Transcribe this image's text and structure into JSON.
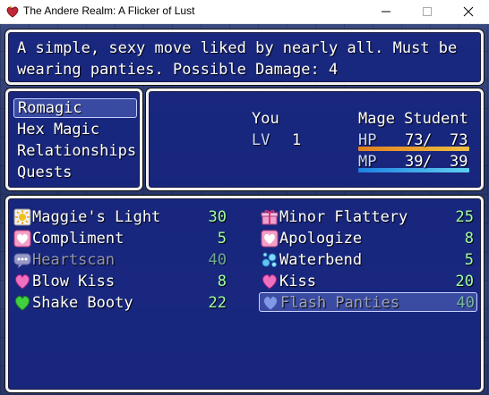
{
  "window": {
    "title": "The Andere Realm: A Flicker of Lust"
  },
  "help": {
    "line1": "A simple, sexy move liked by nearly all. Must be",
    "line2": "wearing panties. Possible Damage: 4"
  },
  "menu": {
    "items": [
      "Romagic",
      "Hex Magic",
      "Relationships",
      "Quests"
    ],
    "selected": "Romagic"
  },
  "status": {
    "name": "You",
    "level_label": "LV",
    "level": "1",
    "class": "Mage Student",
    "hp_label": "HP",
    "hp_current": "73",
    "hp_max": "73",
    "mp_label": "MP",
    "mp_current": "39",
    "mp_max": "39",
    "hp_fill": 1.0,
    "mp_fill": 1.0,
    "hp_color": "#e0a030",
    "mp_color": "#40a0e0"
  },
  "skills": {
    "left": [
      {
        "icon": "sun-icon",
        "name": "Maggie's Light",
        "cost": "30",
        "enabled": true
      },
      {
        "icon": "heart-face-icon",
        "name": "Compliment",
        "cost": "5",
        "enabled": true
      },
      {
        "icon": "speech-bubble-icon",
        "name": "Heartscan",
        "cost": "40",
        "enabled": false
      },
      {
        "icon": "pink-heart-icon",
        "name": "Blow Kiss",
        "cost": "8",
        "enabled": true
      },
      {
        "icon": "green-heart-icon",
        "name": "Shake Booty",
        "cost": "22",
        "enabled": true
      }
    ],
    "right": [
      {
        "icon": "gift-icon",
        "name": "Minor Flattery",
        "cost": "25",
        "enabled": true
      },
      {
        "icon": "heart-face-icon",
        "name": "Apologize",
        "cost": "8",
        "enabled": true
      },
      {
        "icon": "bubbles-icon",
        "name": "Waterbend",
        "cost": "5",
        "enabled": true
      },
      {
        "icon": "pink-heart-icon",
        "name": "Kiss",
        "cost": "20",
        "enabled": true
      },
      {
        "icon": "blue-heart-icon",
        "name": "Flash Panties",
        "cost": "40",
        "enabled": false
      }
    ],
    "selected": "Flash Panties"
  },
  "colors": {
    "window_bg": "#162480",
    "text": "#ffffff",
    "system_text": "#c8d8ff"
  }
}
